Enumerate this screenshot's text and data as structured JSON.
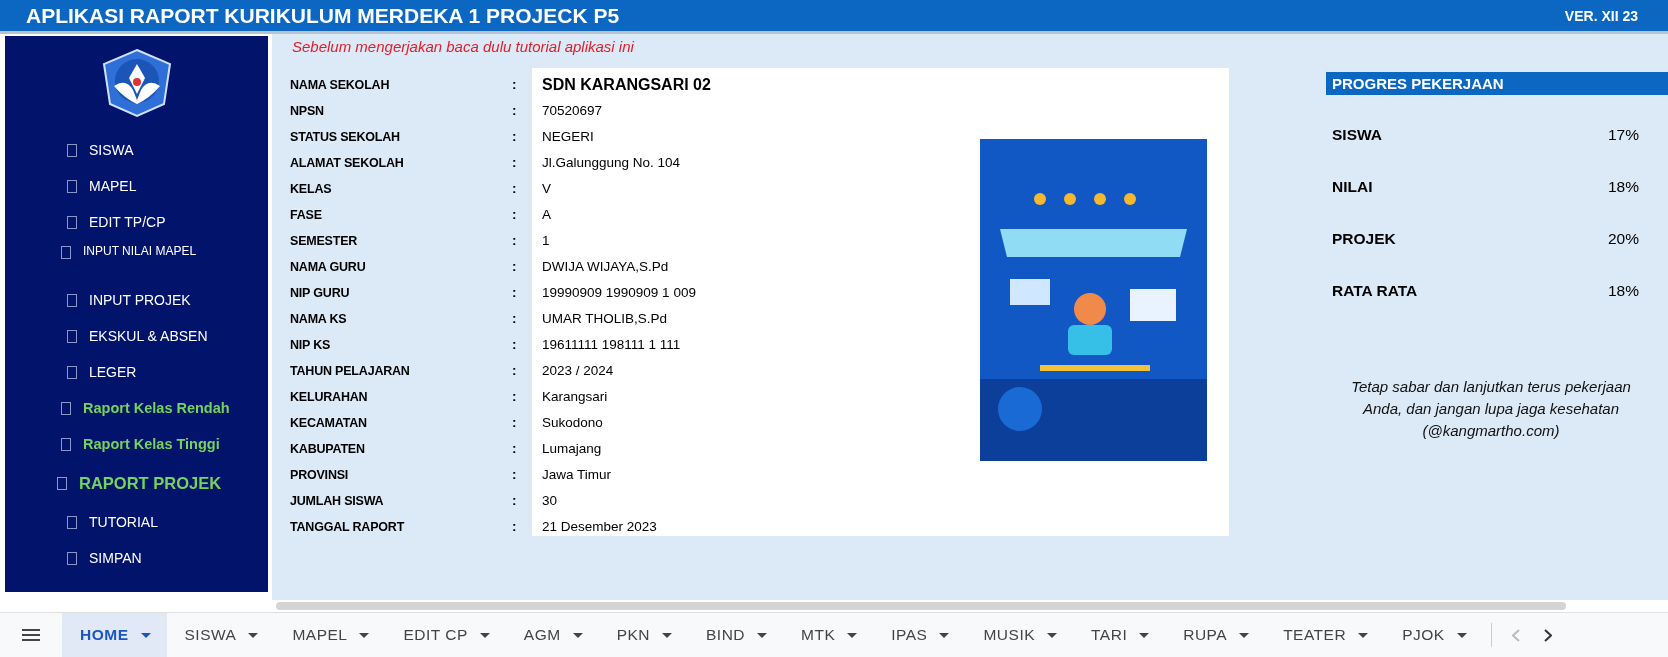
{
  "header": {
    "title": "APLIKASI RAPORT KURIKULUM MERDEKA 1 PROJECK P5",
    "version": "VER. XII 23"
  },
  "sidebar": {
    "items": [
      {
        "label": "SISWA",
        "kind": "menu"
      },
      {
        "label": "MAPEL",
        "kind": "menu"
      },
      {
        "label": "EDIT TP/CP",
        "kind": "menu"
      },
      {
        "label": "INPUT NILAI MAPEL",
        "kind": "small"
      },
      {
        "label": "INPUT PROJEK",
        "kind": "menu"
      },
      {
        "label": "EKSKUL & ABSEN",
        "kind": "menu"
      },
      {
        "label": "LEGER",
        "kind": "menu"
      },
      {
        "label": "Raport Kelas Rendah",
        "kind": "report"
      },
      {
        "label": "Raport Kelas Tinggi",
        "kind": "report"
      },
      {
        "label": "RAPORT PROJEK",
        "kind": "report-large"
      },
      {
        "label": "TUTORIAL",
        "kind": "menu"
      },
      {
        "label": "SIMPAN",
        "kind": "menu"
      }
    ]
  },
  "notice": "Sebelum mengerjakan baca dulu tutorial aplikasi ini",
  "form": {
    "fields": [
      {
        "label": "NAMA SEKOLAH",
        "separator": ":",
        "value": "SDN KARANGSARI 02",
        "kind": "heading"
      },
      {
        "label": "NPSN",
        "separator": ":",
        "value": "70520697",
        "kind": "plain"
      },
      {
        "label": "STATUS SEKOLAH",
        "separator": ":",
        "value": "NEGERI",
        "kind": "plain"
      },
      {
        "label": "ALAMAT SEKOLAH",
        "separator": ":",
        "value": "Jl.Galunggung No. 104",
        "kind": "plain"
      },
      {
        "label": "KELAS",
        "separator": ":",
        "value": "V",
        "kind": "plain"
      },
      {
        "label": "FASE",
        "separator": ":",
        "value": "A",
        "kind": "plain"
      },
      {
        "label": "SEMESTER",
        "separator": ":",
        "value": "1",
        "kind": "plain"
      },
      {
        "label": "NAMA GURU",
        "separator": ":",
        "value": "DWIJA WIJAYA,S.Pd",
        "kind": "plain"
      },
      {
        "label": "NIP GURU",
        "separator": ":",
        "value": "19990909 1990909 1 009",
        "kind": "plain"
      },
      {
        "label": "NAMA KS",
        "separator": ":",
        "value": "UMAR THOLIB,S.Pd",
        "kind": "plain"
      },
      {
        "label": "NIP KS",
        "separator": ":",
        "value": "19611111 198111 1 111",
        "kind": "plain"
      },
      {
        "label": "TAHUN PELAJARAN",
        "separator": ":",
        "value": "2023 / 2024",
        "kind": "plain"
      },
      {
        "label": "KELURAHAN",
        "separator": ":",
        "value": "Karangsari",
        "kind": "plain"
      },
      {
        "label": "KECAMATAN",
        "separator": ":",
        "value": "Sukodono",
        "kind": "plain"
      },
      {
        "label": "KABUPATEN",
        "separator": ":",
        "value": "Lumajang",
        "kind": "plain"
      },
      {
        "label": "PROVINSI",
        "separator": ":",
        "value": "Jawa Timur",
        "kind": "plain"
      },
      {
        "label": "JUMLAH SISWA",
        "separator": ":",
        "value": "30",
        "kind": "plain"
      },
      {
        "label": "TANGGAL RAPORT",
        "separator": ":",
        "value": "21 Desember 2023",
        "kind": "plain"
      }
    ]
  },
  "progress": {
    "title": "PROGRES PEKERJAAN",
    "items": [
      {
        "label": "SISWA",
        "value": "17%"
      },
      {
        "label": "NILAI",
        "value": "18%"
      },
      {
        "label": "PROJEK",
        "value": "20%"
      },
      {
        "label": "RATA RATA",
        "value": "18%"
      }
    ],
    "message": "Tetap sabar dan lanjutkan terus pekerjaan Anda, dan jangan lupa jaga kesehatan (@kangmartho.com)"
  },
  "sheet_tabs": [
    {
      "label": "HOME",
      "selected": true
    },
    {
      "label": "SISWA",
      "selected": false
    },
    {
      "label": "MAPEL",
      "selected": false
    },
    {
      "label": "EDIT CP",
      "selected": false
    },
    {
      "label": "AGM",
      "selected": false
    },
    {
      "label": "PKN",
      "selected": false
    },
    {
      "label": "BIND",
      "selected": false
    },
    {
      "label": "MTK",
      "selected": false
    },
    {
      "label": "IPAS",
      "selected": false
    },
    {
      "label": "MUSIK",
      "selected": false
    },
    {
      "label": "TARI",
      "selected": false
    },
    {
      "label": "RUPA",
      "selected": false
    },
    {
      "label": "TEATER",
      "selected": false
    },
    {
      "label": "PJOK",
      "selected": false
    }
  ]
}
